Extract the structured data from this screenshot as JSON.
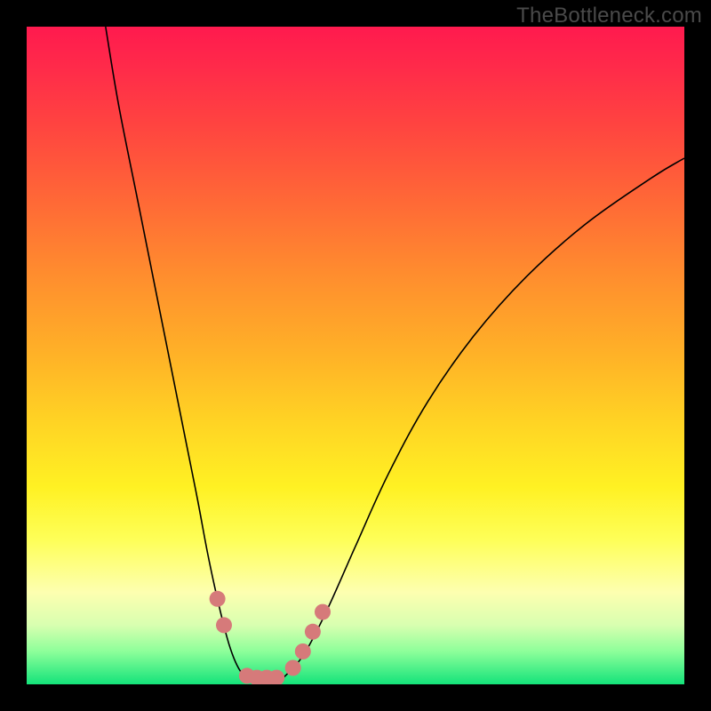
{
  "watermark": "TheBottleneck.com",
  "chart_data": {
    "type": "line",
    "title": "",
    "xlabel": "",
    "ylabel": "",
    "xlim": [
      0,
      100
    ],
    "ylim": [
      0,
      100
    ],
    "grid": false,
    "legend": false,
    "curve_left": {
      "name": "left-branch",
      "x": [
        12,
        14,
        17,
        20,
        22,
        24,
        26,
        27.5,
        29,
        30.5,
        31.5,
        32.5,
        33.5
      ],
      "y": [
        100,
        88,
        73,
        58,
        48,
        38,
        28,
        20,
        13,
        7,
        4,
        2,
        1
      ]
    },
    "curve_right": {
      "name": "right-branch",
      "x": [
        39,
        41,
        43,
        46,
        50,
        55,
        61,
        68,
        76,
        85,
        95,
        100
      ],
      "y": [
        1,
        3,
        6,
        12,
        21,
        32,
        43,
        53,
        62,
        70,
        77,
        80
      ]
    },
    "floor": {
      "name": "valley-floor",
      "x": [
        33.5,
        39
      ],
      "y": [
        0.7,
        0.7
      ]
    },
    "markers": {
      "name": "highlight-points",
      "points": [
        {
          "x": 29.0,
          "y": 13.0
        },
        {
          "x": 30.0,
          "y": 9.0
        },
        {
          "x": 33.5,
          "y": 1.3
        },
        {
          "x": 35.0,
          "y": 1.0
        },
        {
          "x": 36.5,
          "y": 1.0
        },
        {
          "x": 38.0,
          "y": 1.0
        },
        {
          "x": 40.5,
          "y": 2.5
        },
        {
          "x": 42.0,
          "y": 5.0
        },
        {
          "x": 43.5,
          "y": 8.0
        },
        {
          "x": 45.0,
          "y": 11.0
        }
      ]
    }
  }
}
